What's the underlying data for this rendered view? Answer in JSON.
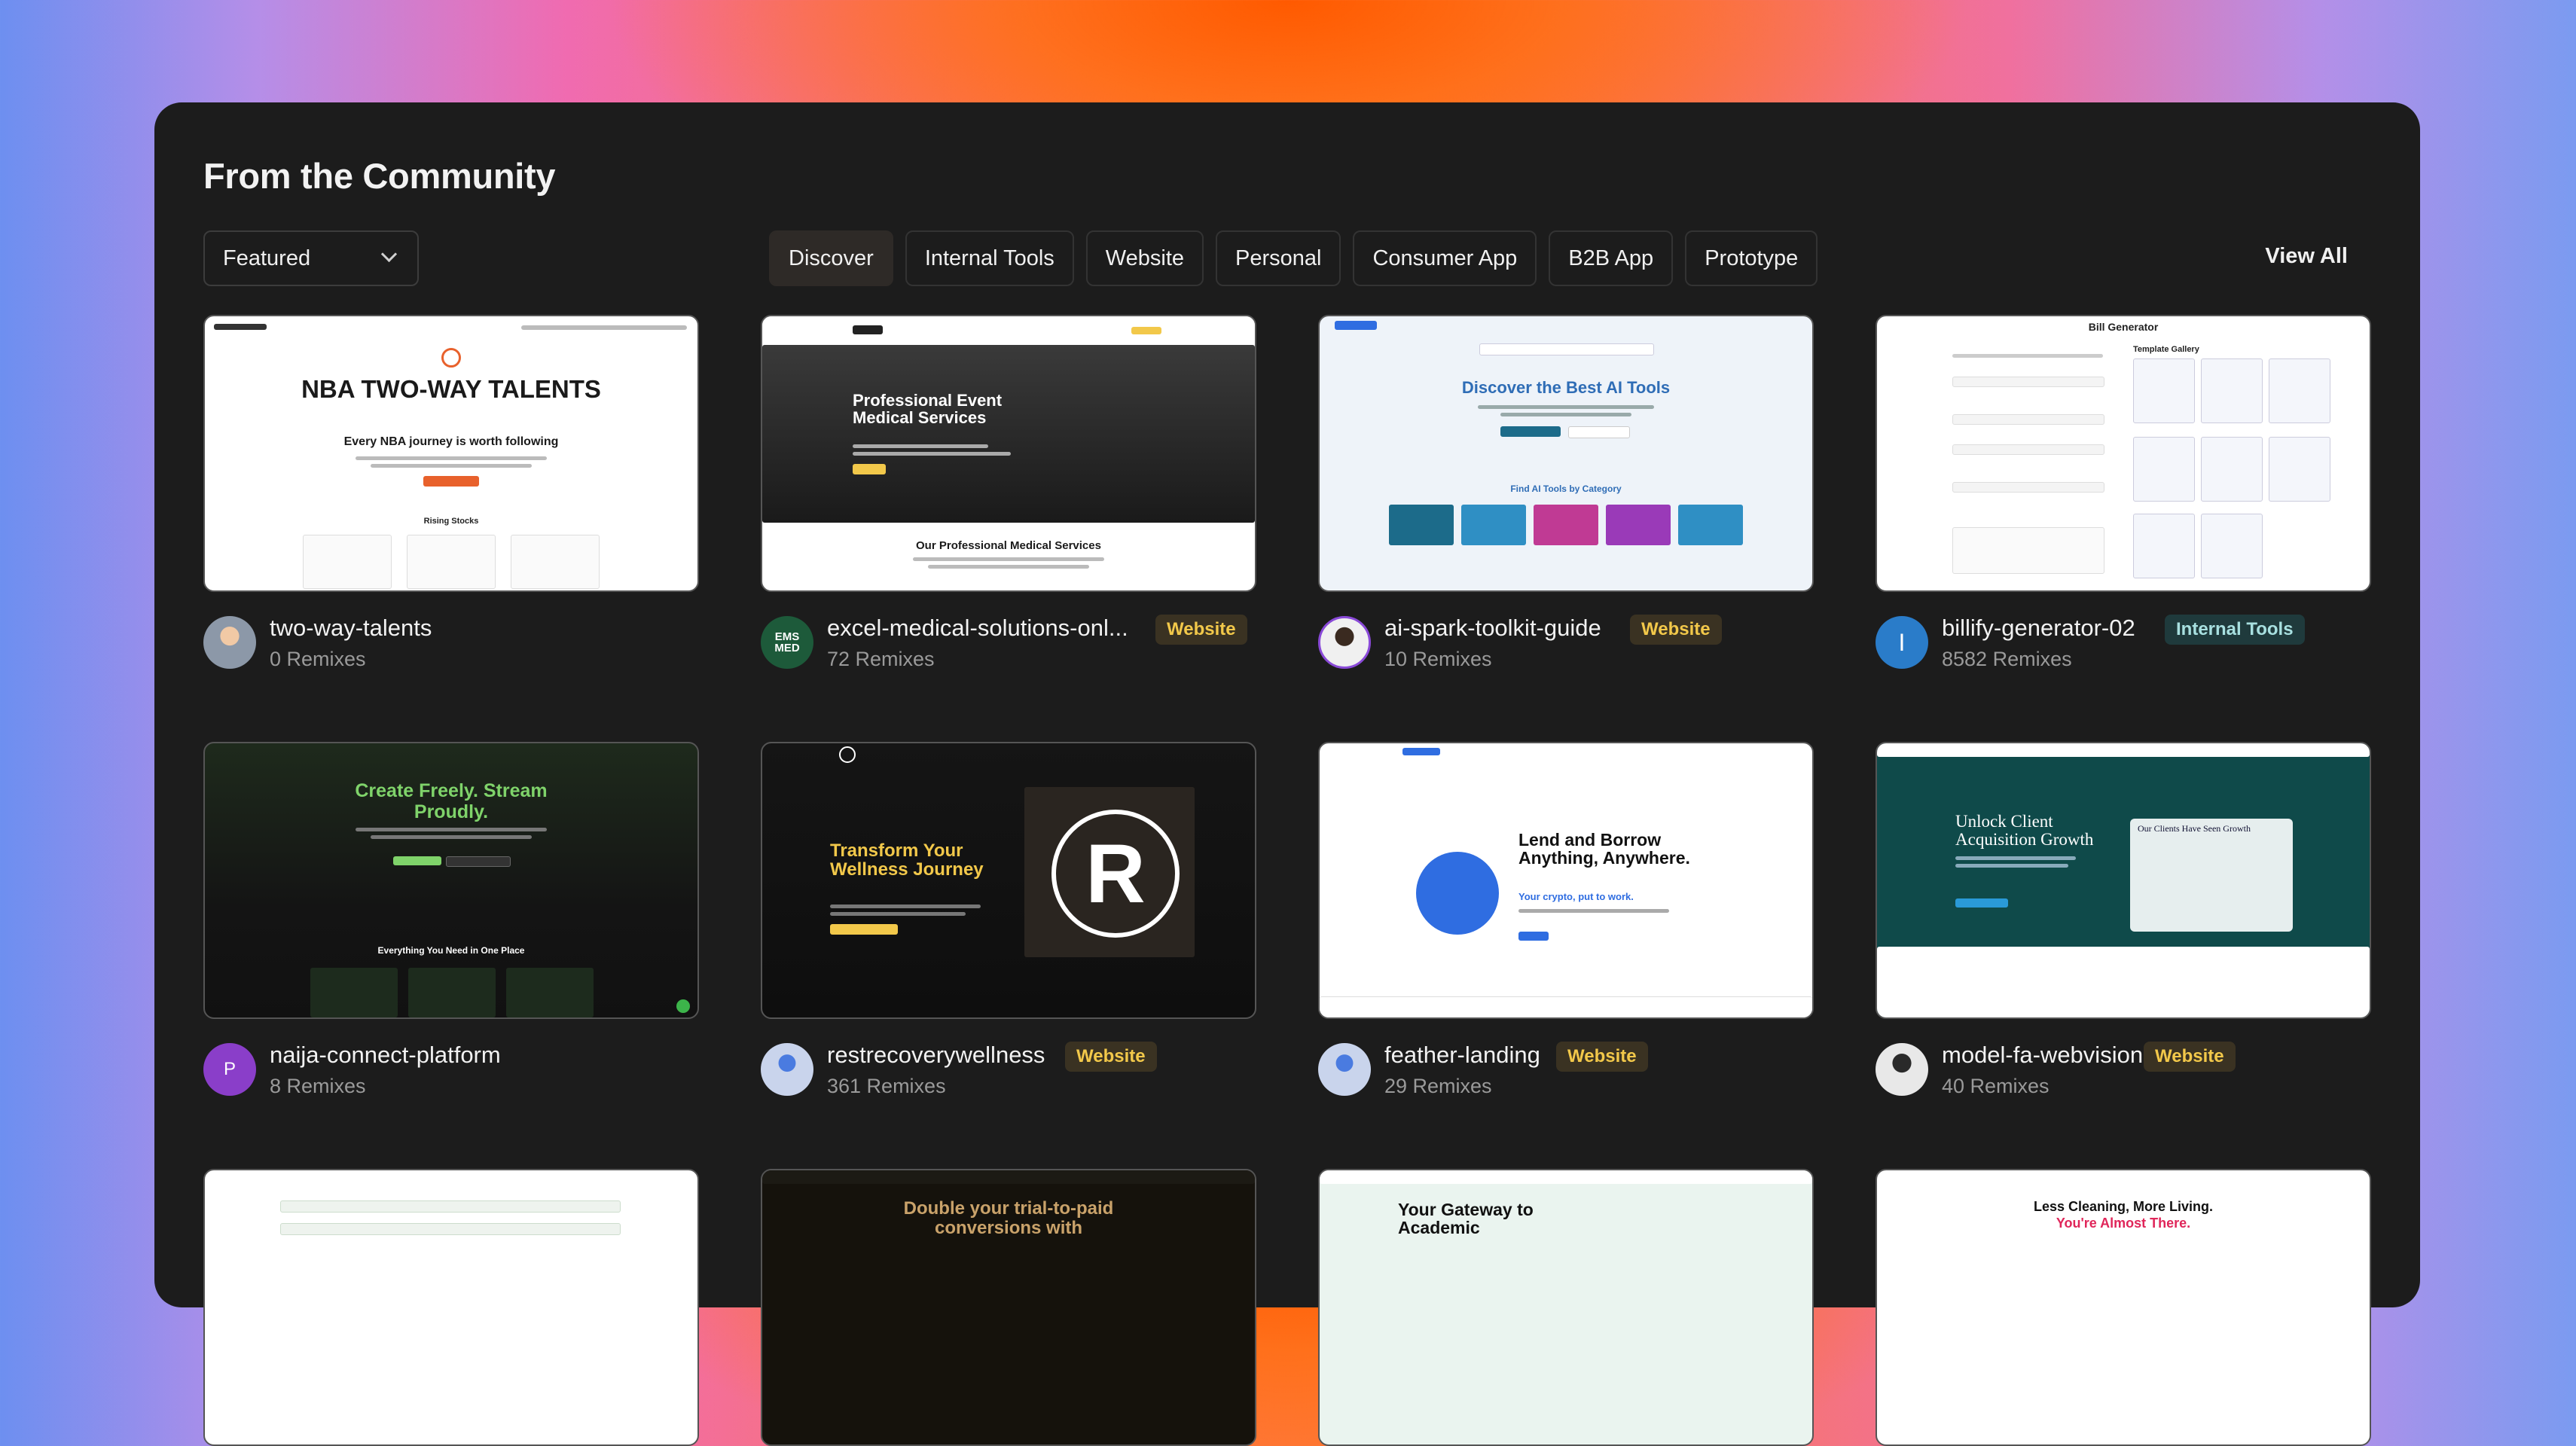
{
  "header": {
    "title": "From the Community"
  },
  "filter": {
    "selected": "Featured"
  },
  "tabs": [
    "Discover",
    "Internal Tools",
    "Website",
    "Personal",
    "Consumer App",
    "B2B App",
    "Prototype"
  ],
  "view_all": "View All",
  "cards": [
    {
      "name": "two-way-talents",
      "remixes": "0 Remixes",
      "badge": "",
      "thumb": {
        "heading": "NBA TWO-WAY TALENTS",
        "sub": "Every NBA journey is worth following",
        "section": "Rising Stocks"
      }
    },
    {
      "name": "excel-medical-solutions-onl...",
      "remixes": "72 Remixes",
      "badge": "Website",
      "avatar_text": "EMS MED",
      "thumb": {
        "heading": "Professional Event Medical Services",
        "section": "Our Professional Medical Services"
      }
    },
    {
      "name": "ai-spark-toolkit-guide",
      "remixes": "10 Remixes",
      "badge": "Website",
      "thumb": {
        "heading": "Discover the Best AI Tools",
        "section": "Find AI Tools by Category"
      }
    },
    {
      "name": "billify-generator-02",
      "remixes": "8582 Remixes",
      "badge": "Internal Tools",
      "avatar_text": "I",
      "thumb": {
        "heading": "Bill Generator",
        "section": "Template Gallery"
      }
    },
    {
      "name": "naija-connect-platform",
      "remixes": "8 Remixes",
      "badge": "",
      "avatar_text": "P",
      "thumb": {
        "heading": "Create Freely. Stream Proudly.",
        "section": "Everything You Need in One Place"
      }
    },
    {
      "name": "restrecoverywellness",
      "remixes": "361 Remixes",
      "badge": "Website",
      "thumb": {
        "heading": "Transform Your Wellness Journey"
      }
    },
    {
      "name": "feather-landing",
      "remixes": "29 Remixes",
      "badge": "Website",
      "thumb": {
        "heading": "Lend and Borrow Anything, Anywhere.",
        "sub": "Your crypto, put to work."
      }
    },
    {
      "name": "model-fa-webvision",
      "remixes": "40 Remixes",
      "badge": "Website",
      "thumb": {
        "heading": "Unlock Client Acquisition Growth",
        "section": "Our Clients Have Seen Growth"
      }
    }
  ],
  "peek": {
    "c2": "Double your trial-to-paid conversions with",
    "c3": "Your Gateway to Academic",
    "c4a": "Less Cleaning, More Living.",
    "c4b": "You're Almost There."
  },
  "colors": {
    "accent": "#f2c84a",
    "panel": "#1c1c1c"
  }
}
